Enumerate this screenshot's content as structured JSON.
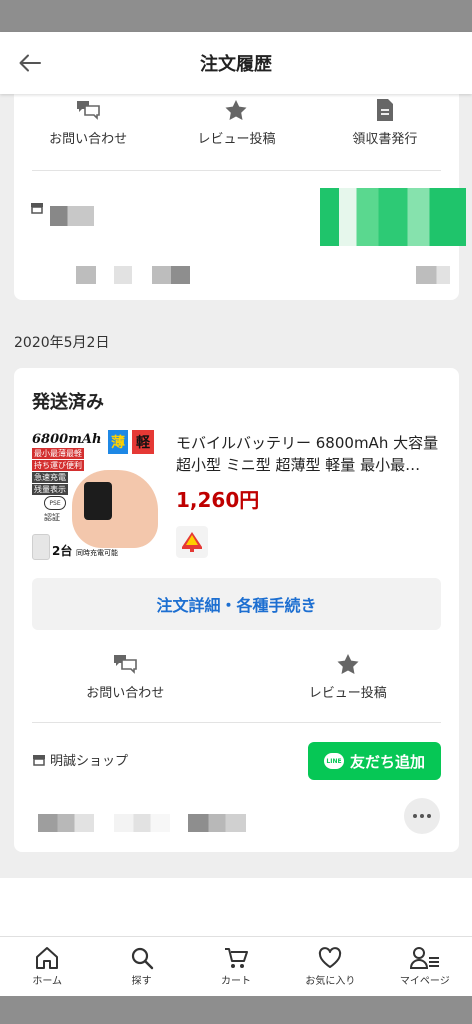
{
  "header": {
    "title": "注文履歴"
  },
  "prev_order": {
    "actions": [
      {
        "label": "お問い合わせ",
        "icon": "chat-icon"
      },
      {
        "label": "レビュー投稿",
        "icon": "star-icon"
      },
      {
        "label": "領収書発行",
        "icon": "document-icon"
      }
    ]
  },
  "order": {
    "date": "2020年5月2日",
    "status": "発送済み",
    "product": {
      "name": "モバイルバッテリー 6800mAh 大容量 超小型 ミニ型 超薄型 軽量 最小最…",
      "price": "1,260円",
      "thumb": {
        "capacity": "6800mAh",
        "badge1": "薄",
        "badge2": "軽",
        "tag1": "最小最薄最軽",
        "tag2": "持ち運び便利",
        "tag3": "急速充電",
        "tag4": "残量表示",
        "pse": "PSE",
        "cert": "認証",
        "bottom_big": "2台",
        "bottom_small": "同時充電可能"
      }
    },
    "detail_button": "注文詳細・各種手続き",
    "actions": [
      {
        "label": "お問い合わせ",
        "icon": "chat-icon"
      },
      {
        "label": "レビュー投稿",
        "icon": "star-icon"
      }
    ],
    "shop_name": "明誠ショップ",
    "friend_button": "友だち追加",
    "line_logo": "LINE"
  },
  "tabbar": [
    {
      "label": "ホーム",
      "icon": "home-icon"
    },
    {
      "label": "探す",
      "icon": "search-icon"
    },
    {
      "label": "カート",
      "icon": "cart-icon"
    },
    {
      "label": "お気に入り",
      "icon": "heart-icon"
    },
    {
      "label": "マイページ",
      "icon": "user-icon"
    }
  ],
  "colors": {
    "accent_blue": "#1d6fd1",
    "price_red": "#bf0000",
    "line_green": "#06c755"
  }
}
